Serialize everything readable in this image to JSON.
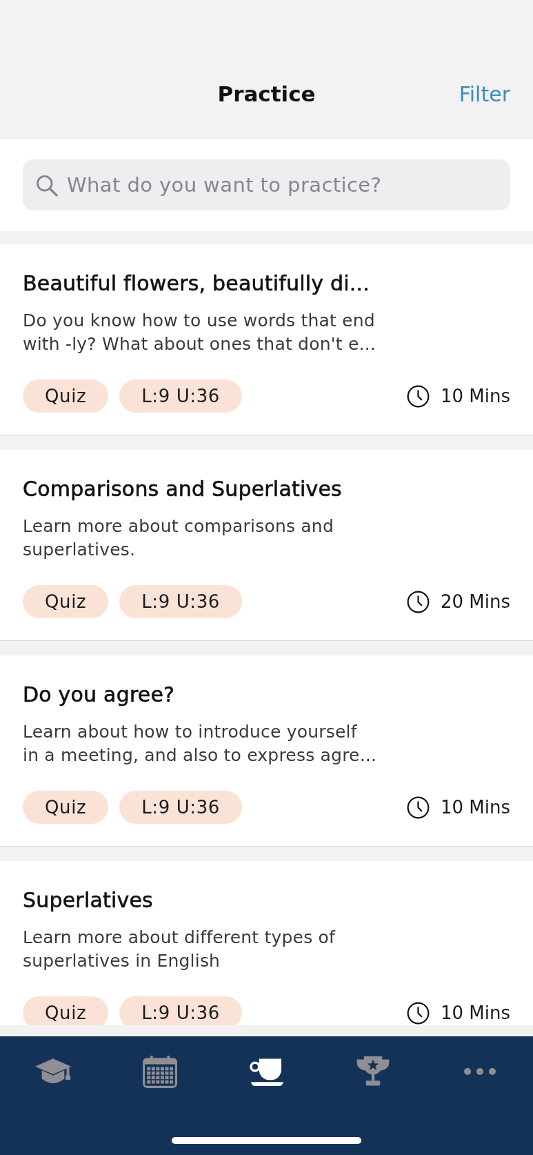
{
  "header": {
    "title": "Practice",
    "filter_button": "Filter"
  },
  "search": {
    "placeholder": "What do you want to practice?"
  },
  "lessons": [
    {
      "title": "Beautiful flowers, beautifully di...",
      "description": "Do you know how to use words that end\nwith -ly? What about ones that don't e...",
      "tags": [
        "Quiz",
        "L:9 U:36"
      ],
      "duration": "10 Mins"
    },
    {
      "title": "Comparisons and Superlatives",
      "description": "Learn more about comparisons and\nsuperlatives.",
      "tags": [
        "Quiz",
        "L:9 U:36"
      ],
      "duration": "20 Mins"
    },
    {
      "title": "Do you agree?",
      "description": "Learn about how to introduce yourself\nin a meeting, and also to express agre...",
      "tags": [
        "Quiz",
        "L:9 U:36"
      ],
      "duration": "10 Mins"
    },
    {
      "title": "Superlatives",
      "description": "Learn more about different types of\nsuperlatives in English",
      "tags": [
        "Quiz",
        "L:9 U:36"
      ],
      "duration": "10 Mins"
    }
  ],
  "tab_bar": {
    "tabs": [
      {
        "kind": "cap",
        "selected": false
      },
      {
        "kind": "calendar",
        "selected": false
      },
      {
        "kind": "cup",
        "selected": true
      },
      {
        "kind": "trophy",
        "selected": false
      },
      {
        "kind": "more",
        "selected": false
      }
    ]
  }
}
